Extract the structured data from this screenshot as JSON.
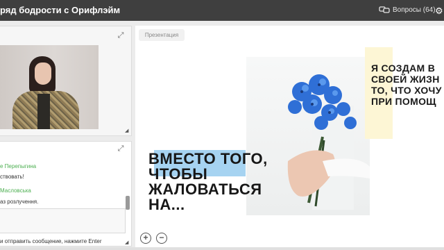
{
  "header": {
    "title": "ряд бодрости с Орифлэйм",
    "questions_label": "Вопросы (64)",
    "questions_icon": "chat-bubbles-icon",
    "settings_icon": "gear-icon"
  },
  "video": {
    "expand_icon": "expand-icon",
    "resize_icon": "resize-corner-icon"
  },
  "chat": {
    "expand_icon": "expand-icon",
    "messages": [
      {
        "author": "е Перепыгина",
        "text": "ствовать!"
      },
      {
        "author": "Масловська",
        "text": "аз розлучення."
      }
    ],
    "hint": "и отправить сообщение, нажмите Enter"
  },
  "presentation": {
    "tab_label": "Презентация",
    "headline": [
      "ВМЕСТО ТОГО,",
      "ЧТОБЫ",
      "ЖАЛОВАТЬСЯ",
      "НА..."
    ],
    "side_text": [
      "Я СОЗДАМ В",
      "СВОЕЙ ЖИЗН",
      "ТО, ЧТО ХОЧУ",
      "ПРИ ПОМОЩ"
    ],
    "zoom_in_label": "+",
    "zoom_out_label": "−",
    "colors": {
      "highlight_blue": "#a6d3f1",
      "highlight_yellow": "#fdf6d5",
      "flowers": "#2f6fd6"
    }
  }
}
